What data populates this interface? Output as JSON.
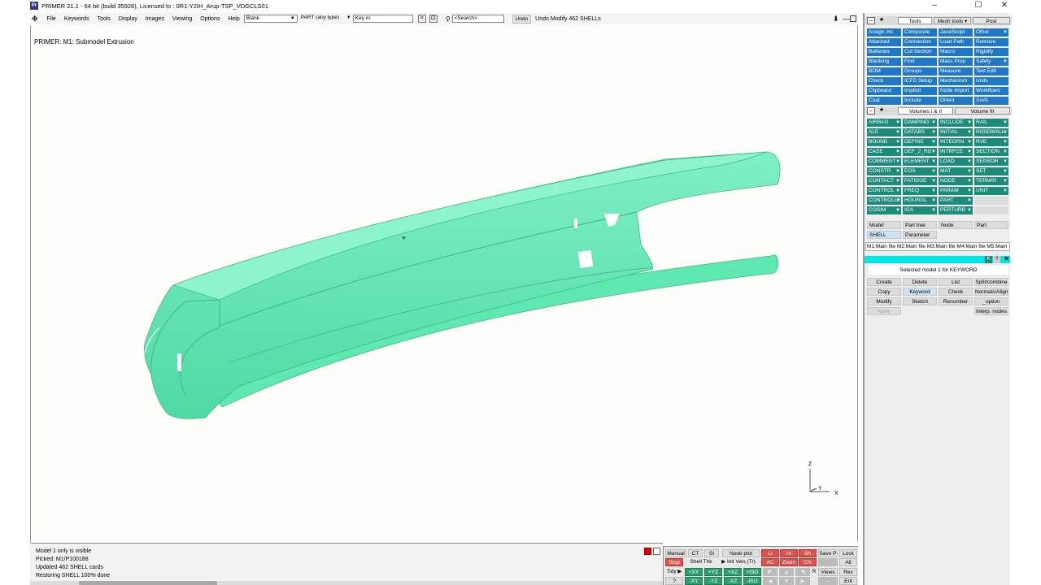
{
  "window": {
    "title": "PRIMER 21.1 - 64 bit (build 35928), Licensed to : 0R1-Y2IH_Arup-TSP_VDGCLS01",
    "logo_text": "Pr",
    "controls": [
      "–",
      "☐",
      "✕"
    ]
  },
  "menubar": {
    "menus": [
      "File",
      "Keywords",
      "Tools",
      "Display",
      "Images",
      "Viewing",
      "Options",
      "Help"
    ],
    "blank_select": "Blank",
    "type_select": "PART  (any type)",
    "key_in": "Key in:",
    "search_placeholder": "<Search>",
    "undo_label": "Undo",
    "undo_text": "Undo Modify 462 SHELLs"
  },
  "viewport": {
    "caption": "PRIMER: M1: Submodel Extrusion",
    "model_color": "#5fe8b0",
    "triad": {
      "z": "Z",
      "y": "Y",
      "x": "X"
    }
  },
  "messages": [
    "Model 1 only is visible",
    "Picked: M1/P100188",
    "Updated 462 SHELL cards",
    "Restoring SHELL 100% done"
  ],
  "controls": {
    "manual": "Manual",
    "ct": "CT",
    "si": "SI",
    "node_plot": "Node plot",
    "save": "Save P",
    "lock": "Lock",
    "stop": "Stop",
    "shell_thk": "Shell Thk",
    "init_vels": "▶ Init Vels (Tr)",
    "ac": "AC",
    "zoom": "Zoom",
    "cn": "CN",
    "all": "All",
    "tidy": "Tidy ▶",
    "pxy": "+XY",
    "pyz": "+YZ",
    "pxz": "+XZ",
    "piso": "+ISO",
    "views": "Views",
    "rev": "Rev",
    "q": "?",
    "nxy": "-XY",
    "nyz": "-YZ",
    "nxz": "-XZ",
    "niso": "-ISO",
    "ent": "Ent",
    "li": "Li",
    "hi": "Hi",
    "sh": "Sh",
    "r": "R"
  },
  "tools_header": {
    "tab_tools": "Tools",
    "tab_mesh": "Mesh tools ▾",
    "tab_post": "Post"
  },
  "tools": [
    [
      "Assign ms",
      "Composite",
      "JavaScript",
      "Other"
    ],
    [
      "Attached",
      "Connection",
      "Load Path",
      "Remove"
    ],
    [
      "Batteries",
      "Cut Section",
      "Macro",
      "Rigidify"
    ],
    [
      "Blanking",
      "Find",
      "Mass Prop",
      "Safety"
    ],
    [
      "BOM",
      "Groups",
      "Measure",
      "Text Edit"
    ],
    [
      "Check",
      "ICFD Setup",
      "Mechanism",
      "Units"
    ],
    [
      "Clipboard",
      "Implicit",
      "Node Import",
      "Workflows"
    ],
    [
      "Coat",
      "Include",
      "Orient",
      "Xrefs"
    ]
  ],
  "keywords_header": {
    "tab1": "Volumes I & II",
    "tab2": "Volume III"
  },
  "keywords": [
    [
      "AIRBAG",
      "DAMPING",
      "INCLUDE",
      "RAIL"
    ],
    [
      "ALE",
      "DATABS",
      "INITIAL",
      "RIGIDWALL"
    ],
    [
      "BOUND",
      "DEFINE",
      "INTEGRN",
      "RVE"
    ],
    [
      "CASE",
      "DEF_2_RG",
      "INTRFCE",
      "SECTION"
    ],
    [
      "COMMENT",
      "ELEMENT",
      "LOAD",
      "SENSOR"
    ],
    [
      "CONSTR",
      "EOS",
      "MAT",
      "SET"
    ],
    [
      "CONTACT",
      "FATIGUE",
      "NODE",
      "TERMIN"
    ],
    [
      "CONTROL",
      "FREQ",
      "PARAM",
      "UNIT"
    ],
    [
      "CONTROLLE",
      "HOURGL",
      "PART",
      ""
    ],
    [
      "COSIM",
      "IGA",
      "PERTURB",
      ""
    ]
  ],
  "tree_tabs": [
    "Model",
    "Part tree",
    "Node",
    "Part"
  ],
  "sub_tabs": [
    "SHELL",
    "Parameter"
  ],
  "file_strip": "M1:Main file M2:Main file M3:Main file M4:Main file M5:Main",
  "selected_model": "Selected model 1 for KEYWORD",
  "actions": [
    [
      "Create",
      "Delete",
      "List",
      "Split/combine"
    ],
    [
      "Copy",
      "Keyword",
      "Check",
      "Normals/Align"
    ],
    [
      "Modify",
      "Sketch",
      "Renumber",
      "_option"
    ],
    [
      "Apply",
      "",
      "",
      "Interp. nodes"
    ]
  ]
}
